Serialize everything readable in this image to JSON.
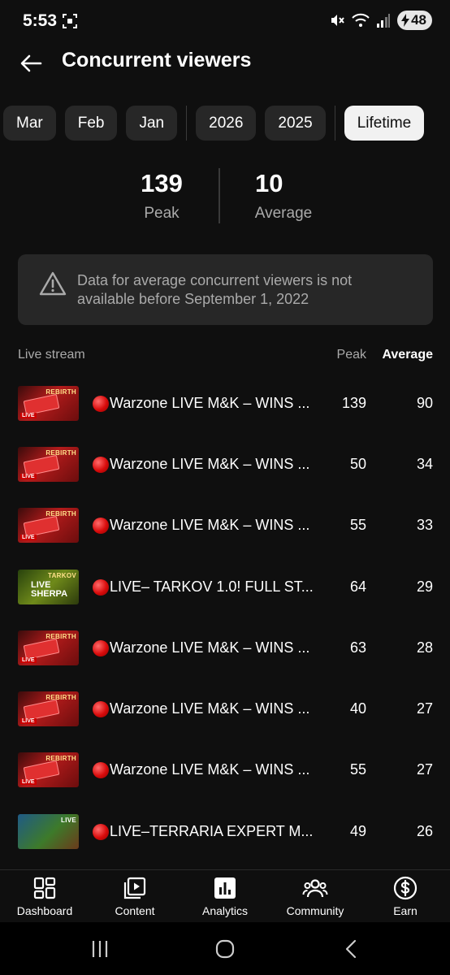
{
  "status_bar": {
    "time": "5:53",
    "battery": "48"
  },
  "header": {
    "title": "Concurrent viewers"
  },
  "chips": [
    {
      "label": "Mar",
      "selected": false
    },
    {
      "label": "Feb",
      "selected": false
    },
    {
      "label": "Jan",
      "selected": false
    },
    {
      "label": "2026",
      "selected": false
    },
    {
      "label": "2025",
      "selected": false
    },
    {
      "label": "Lifetime",
      "selected": true
    }
  ],
  "stats": {
    "peak_value": "139",
    "peak_label": "Peak",
    "average_value": "10",
    "average_label": "Average"
  },
  "notice": {
    "icon": "warning-icon",
    "text": "Data for average concurrent viewers is not available before September 1, 2022"
  },
  "table": {
    "headers": {
      "stream": "Live stream",
      "peak": "Peak",
      "average": "Average"
    },
    "rows": [
      {
        "thumb": "warzone",
        "title": "Warzone LIVE M&K – WINS ...",
        "peak": "139",
        "average": "90"
      },
      {
        "thumb": "warzone",
        "title": "Warzone LIVE M&K – WINS ...",
        "peak": "50",
        "average": "34"
      },
      {
        "thumb": "warzone",
        "title": "Warzone LIVE M&K – WINS ...",
        "peak": "55",
        "average": "33"
      },
      {
        "thumb": "tarkov",
        "title": "LIVE– TARKOV 1.0! FULL ST...",
        "peak": "64",
        "average": "29"
      },
      {
        "thumb": "warzone",
        "title": "Warzone LIVE M&K – WINS ...",
        "peak": "63",
        "average": "28"
      },
      {
        "thumb": "warzone",
        "title": "Warzone LIVE M&K – WINS ...",
        "peak": "40",
        "average": "27"
      },
      {
        "thumb": "warzone",
        "title": "Warzone LIVE M&K – WINS ...",
        "peak": "55",
        "average": "27"
      },
      {
        "thumb": "terraria",
        "title": "LIVE–TERRARIA EXPERT M...",
        "peak": "49",
        "average": "26"
      }
    ]
  },
  "bottom_nav": [
    {
      "label": "Dashboard",
      "icon": "dashboard-icon"
    },
    {
      "label": "Content",
      "icon": "content-icon"
    },
    {
      "label": "Analytics",
      "icon": "analytics-icon"
    },
    {
      "label": "Community",
      "icon": "community-icon"
    },
    {
      "label": "Earn",
      "icon": "earn-icon"
    }
  ],
  "colors": {
    "background": "#0f0f0f",
    "surface": "#272727",
    "selected_chip": "#f1f1f1",
    "secondary_text": "#aaaaaa",
    "live_red": "#d80b0b"
  }
}
